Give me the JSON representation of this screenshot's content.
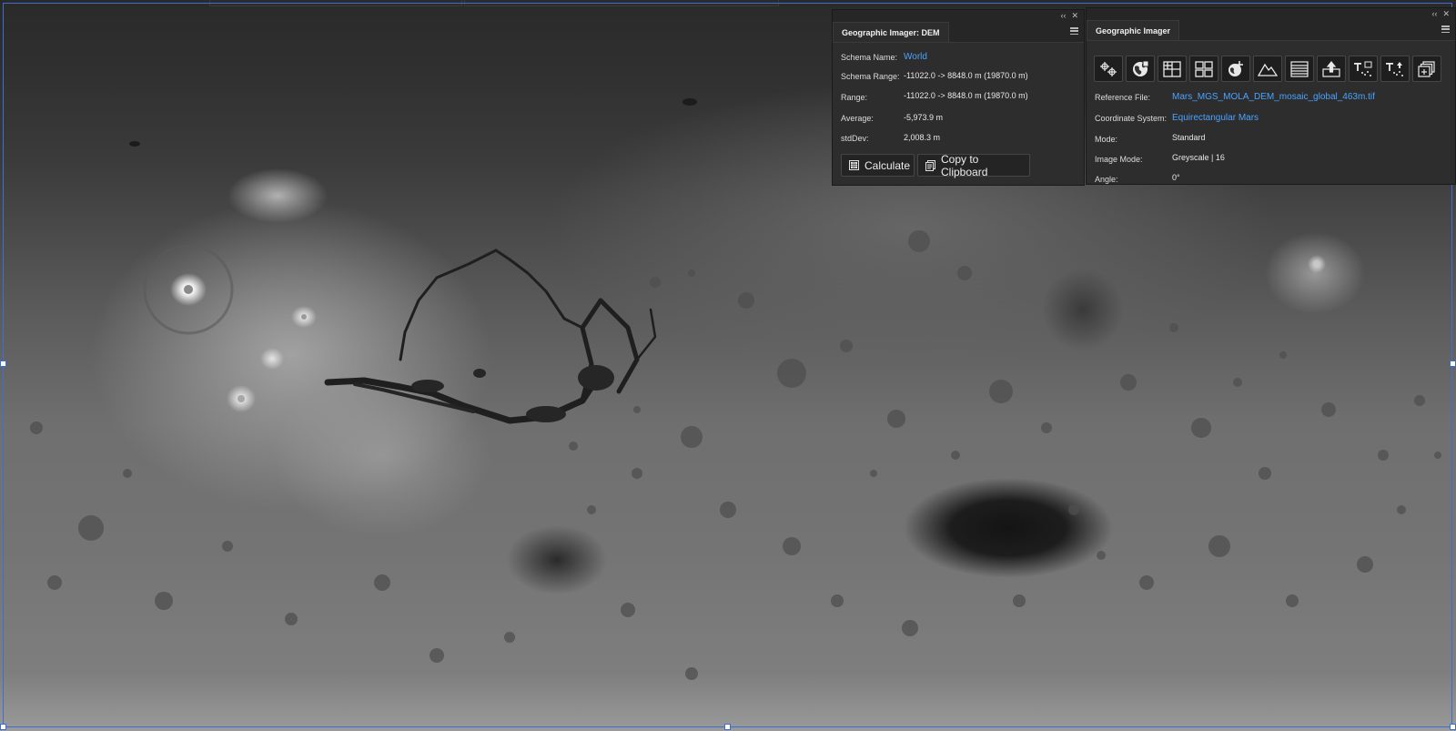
{
  "dem_panel": {
    "title": "Geographic Imager: DEM",
    "labels": {
      "schema_name": "Schema Name:",
      "schema_range": "Schema Range:",
      "range": "Range:",
      "average": "Average:",
      "stddev": "stdDev:"
    },
    "values": {
      "schema_name": "World",
      "schema_range": "-11022.0 -> 8848.0 m (19870.0 m)",
      "range": "-11022.0 -> 8848.0 m (19870.0 m)",
      "average": "-5,973.9 m",
      "stddev": "2,008.3 m"
    },
    "buttons": {
      "calculate": "Calculate",
      "copy": "Copy to Clipboard"
    },
    "controls": {
      "collapse": "‹‹",
      "close": "✕"
    }
  },
  "gi_panel": {
    "title": "Geographic Imager",
    "tools": [
      "register-icon",
      "globe-icon",
      "grid-icon",
      "tile-icon",
      "transform-icon",
      "terrain-icon",
      "table-icon",
      "export-icon",
      "text-import-icon",
      "text-export-icon",
      "mosaic-icon"
    ],
    "labels": {
      "reference_file": "Reference File:",
      "coordinate_system": "Coordinate System:",
      "mode": "Mode:",
      "image_mode": "Image Mode:",
      "angle": "Angle:"
    },
    "values": {
      "reference_file": "Mars_MGS_MOLA_DEM_mosaic_global_463m.tif",
      "coordinate_system": "Equirectangular Mars",
      "mode": "Standard",
      "image_mode": "Greyscale | 16",
      "angle": "0°"
    },
    "controls": {
      "collapse": "‹‹",
      "close": "✕"
    }
  },
  "colors": {
    "link": "#4aa3ff",
    "panel_bg": "#2d2d2d",
    "selection": "#3b6fd0"
  }
}
